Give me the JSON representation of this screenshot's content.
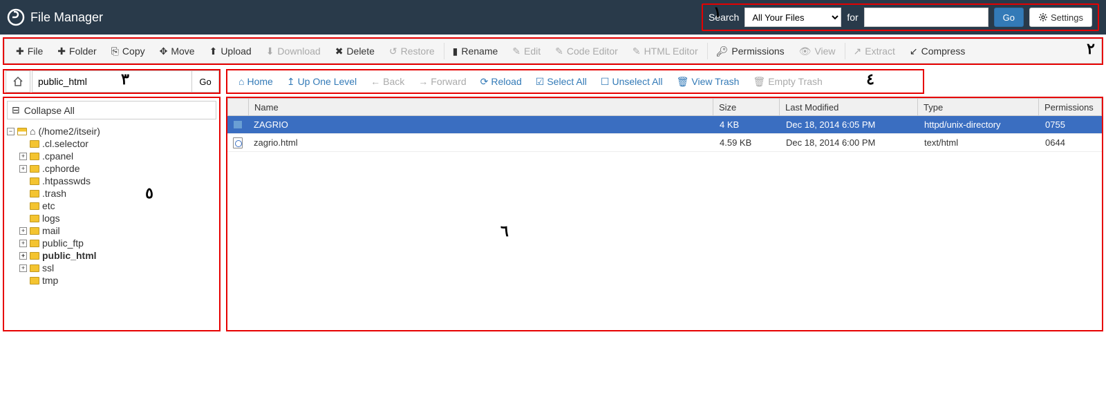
{
  "header": {
    "title": "File Manager",
    "search_label": "Search",
    "search_select": "All Your Files",
    "for_label": "for",
    "search_value": "",
    "go_label": "Go",
    "settings_label": "Settings"
  },
  "annotations": {
    "n1": "١",
    "n2": "٢",
    "n3": "٣",
    "n4": "٤",
    "n5": "٥",
    "n6": "٦"
  },
  "toolbar": {
    "file": "File",
    "folder": "Folder",
    "copy": "Copy",
    "move": "Move",
    "upload": "Upload",
    "download": "Download",
    "delete": "Delete",
    "restore": "Restore",
    "rename": "Rename",
    "edit": "Edit",
    "code_editor": "Code Editor",
    "html_editor": "HTML Editor",
    "permissions": "Permissions",
    "view": "View",
    "extract": "Extract",
    "compress": "Compress"
  },
  "path": {
    "value": "public_html",
    "go": "Go"
  },
  "nav": {
    "home": "Home",
    "up": "Up One Level",
    "back": "Back",
    "forward": "Forward",
    "reload": "Reload",
    "select_all": "Select All",
    "unselect_all": "Unselect All",
    "view_trash": "View Trash",
    "empty_trash": "Empty Trash"
  },
  "sidebar": {
    "collapse": "Collapse All",
    "root": "(/home2/itseir)",
    "items": [
      {
        "name": ".cl.selector",
        "expandable": false
      },
      {
        "name": ".cpanel",
        "expandable": true
      },
      {
        "name": ".cphorde",
        "expandable": true
      },
      {
        "name": ".htpasswds",
        "expandable": false
      },
      {
        "name": ".trash",
        "expandable": false
      },
      {
        "name": "etc",
        "expandable": false
      },
      {
        "name": "logs",
        "expandable": false
      },
      {
        "name": "mail",
        "expandable": true
      },
      {
        "name": "public_ftp",
        "expandable": true
      },
      {
        "name": "public_html",
        "expandable": true,
        "bold": true
      },
      {
        "name": "ssl",
        "expandable": true
      },
      {
        "name": "tmp",
        "expandable": false
      }
    ]
  },
  "table": {
    "headers": {
      "name": "Name",
      "size": "Size",
      "modified": "Last Modified",
      "type": "Type",
      "perms": "Permissions"
    },
    "rows": [
      {
        "icon": "folder",
        "name": "ZAGRIO",
        "size": "4 KB",
        "modified": "Dec 18, 2014 6:05 PM",
        "type": "httpd/unix-directory",
        "perms": "0755",
        "selected": true
      },
      {
        "icon": "html",
        "name": "zagrio.html",
        "size": "4.59 KB",
        "modified": "Dec 18, 2014 6:00 PM",
        "type": "text/html",
        "perms": "0644",
        "selected": false
      }
    ]
  }
}
